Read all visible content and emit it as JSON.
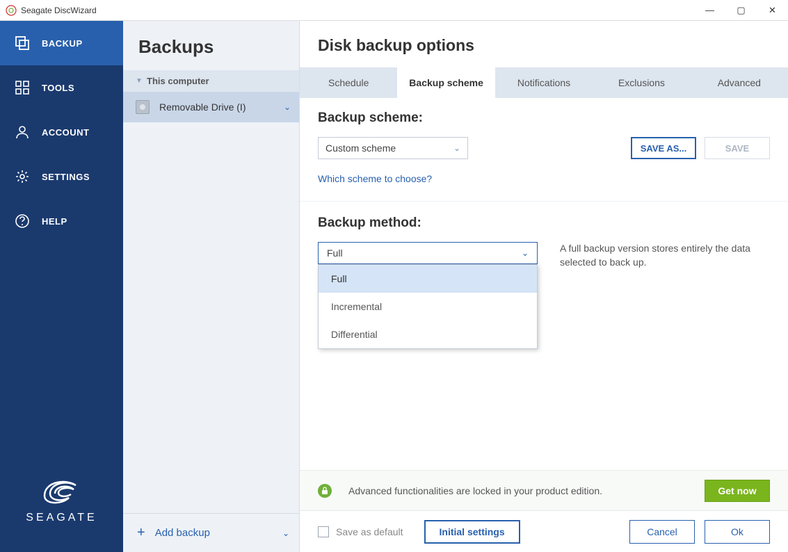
{
  "window": {
    "title": "Seagate DiscWizard"
  },
  "sidebar": {
    "items": [
      {
        "label": "BACKUP"
      },
      {
        "label": "TOOLS"
      },
      {
        "label": "ACCOUNT"
      },
      {
        "label": "SETTINGS"
      },
      {
        "label": "HELP"
      }
    ],
    "logo_text": "SEAGATE"
  },
  "backups_panel": {
    "title": "Backups",
    "tree_header": "This computer",
    "tree_item": "Removable Drive (I)",
    "add_label": "Add backup"
  },
  "main": {
    "header": "Disk backup options",
    "tabs": [
      {
        "label": "Schedule"
      },
      {
        "label": "Backup scheme"
      },
      {
        "label": "Notifications"
      },
      {
        "label": "Exclusions"
      },
      {
        "label": "Advanced"
      }
    ],
    "scheme": {
      "title": "Backup scheme:",
      "selected": "Custom scheme",
      "saveas": "SAVE AS...",
      "save": "SAVE",
      "link": "Which scheme to choose?"
    },
    "method": {
      "title": "Backup method:",
      "selected": "Full",
      "options": [
        {
          "label": "Full"
        },
        {
          "label": "Incremental"
        },
        {
          "label": "Differential"
        }
      ],
      "description": "A full backup version stores entirely the data selected to back up."
    },
    "locked": {
      "msg": "Advanced functionalities are locked in your product edition.",
      "getnow": "Get now"
    },
    "footer": {
      "save_default": "Save as default",
      "initial": "Initial settings",
      "cancel": "Cancel",
      "ok": "Ok"
    }
  }
}
